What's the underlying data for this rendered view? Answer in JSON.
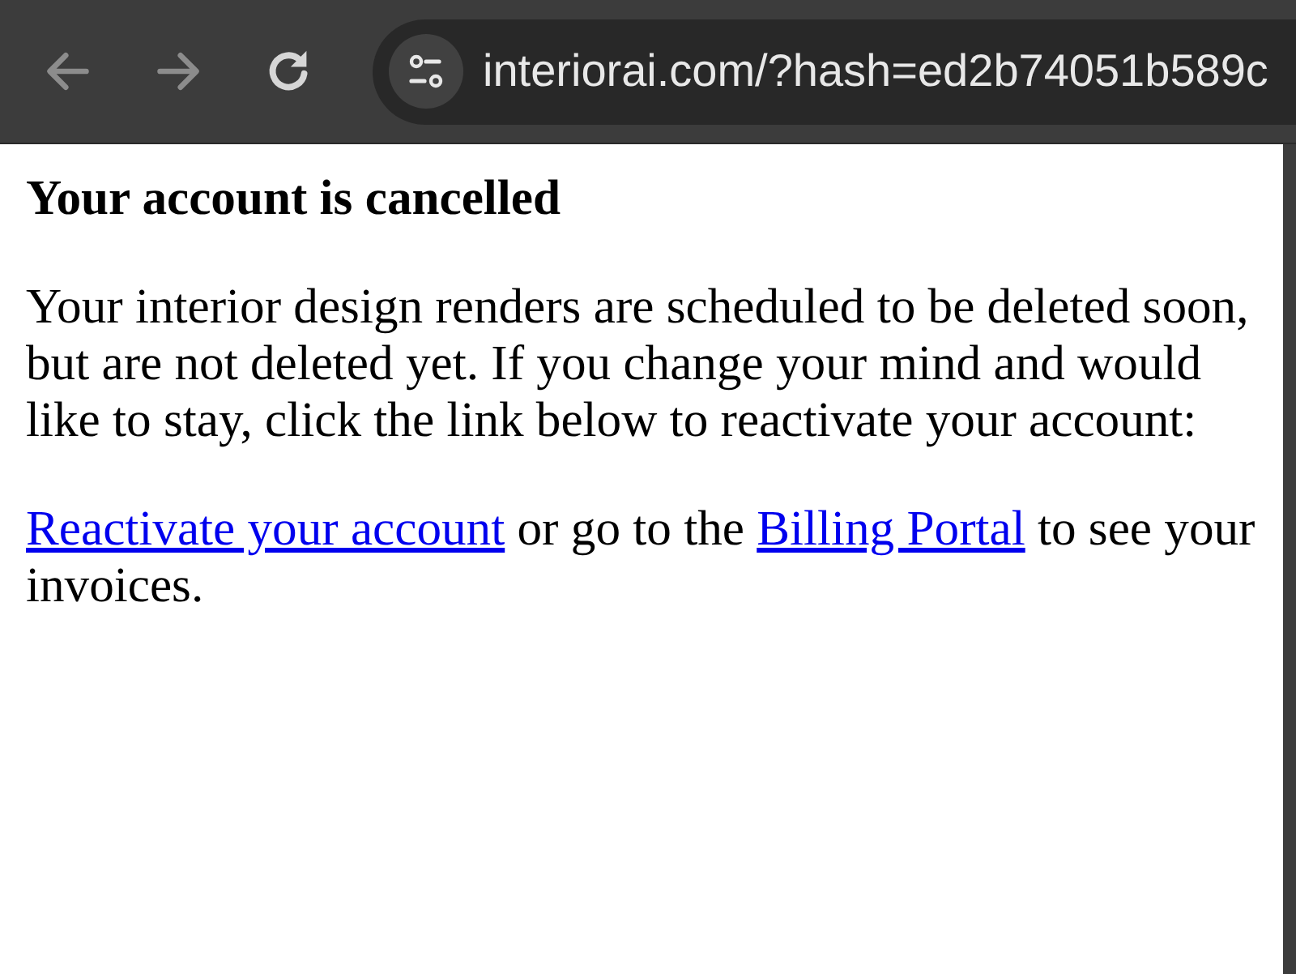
{
  "toolbar_buttons": [
    {
      "kind": "back",
      "disabled": true
    },
    {
      "kind": "forward",
      "disabled": true
    },
    {
      "kind": "reload",
      "disabled": false
    }
  ],
  "address_bar": {
    "url": "interiorai.com/?hash=ed2b74051b589c"
  },
  "page": {
    "heading": "Your account is cancelled",
    "message": "Your interior design renders are scheduled to be deleted soon, but are not deleted yet. If you change your mind and would like to stay, click the link below to reactivate your account:",
    "links_paragraph": [
      {
        "kind": "link",
        "text": "Reactivate your account"
      },
      {
        "kind": "text",
        "text": " or go to the "
      },
      {
        "kind": "link",
        "text": "Billing Portal"
      },
      {
        "kind": "text",
        "text": " to see your invoices."
      }
    ]
  }
}
